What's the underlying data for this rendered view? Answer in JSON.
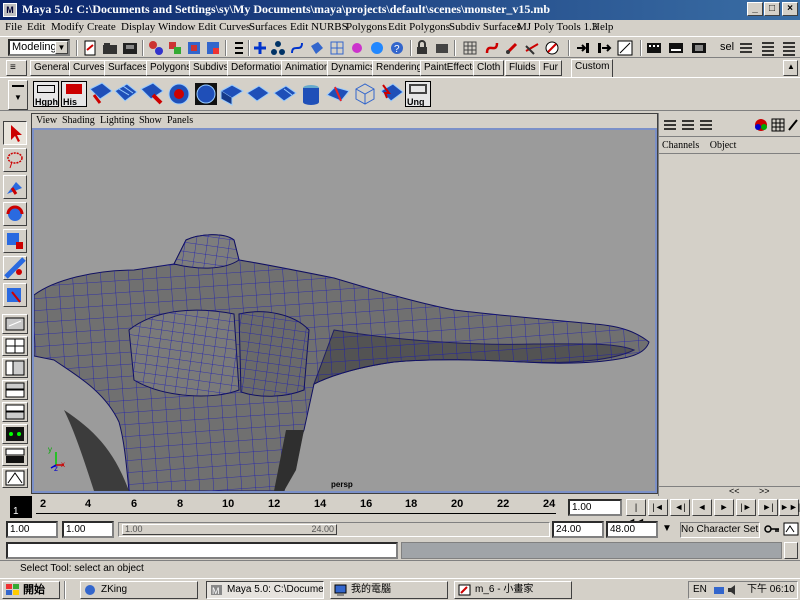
{
  "window": {
    "title": "Maya 5.0: C:\\Documents and Settings\\sy\\My Documents\\maya\\projects\\default\\scenes\\monster_v15.mb",
    "app_icon": "M"
  },
  "menubar": [
    "File",
    "Edit",
    "Modify",
    "Create",
    "Display",
    "Window",
    "Edit Curves",
    "Surfaces",
    "Edit NURBS",
    "Polygons",
    "Edit Polygons",
    "Subdiv Surfaces",
    "MJ Poly Tools 1.3",
    "Help"
  ],
  "status_line": {
    "menu_set": "Modeling",
    "sel_label": "sel"
  },
  "shelf_tabs": [
    "General",
    "Curves",
    "Surfaces",
    "Polygons",
    "Subdivs",
    "Deformation",
    "Animation",
    "Dynamics",
    "Rendering",
    "PaintEffects",
    "Cloth",
    "Fluids",
    "Fur",
    "Custom"
  ],
  "shelf_active": "Custom",
  "shelf_items": [
    {
      "label": "Hgph",
      "icon": "hypergraph-icon"
    },
    {
      "label": "His",
      "icon": "history-icon"
    },
    {
      "label": "",
      "icon": "poly-split-icon"
    },
    {
      "label": "",
      "icon": "poly-extrude-icon"
    },
    {
      "label": "",
      "icon": "poly-append-icon"
    },
    {
      "label": "",
      "icon": "poly-smooth-icon"
    },
    {
      "label": "",
      "icon": "poly-merge-icon"
    },
    {
      "label": "",
      "icon": "poly-cube-icon"
    },
    {
      "label": "",
      "icon": "poly-plane-icon"
    },
    {
      "label": "",
      "icon": "poly-cylinder-icon"
    },
    {
      "label": "",
      "icon": "poly-sphere-icon"
    },
    {
      "label": "",
      "icon": "nurbs-plane-icon"
    },
    {
      "label": "",
      "icon": "poly-wire-icon"
    },
    {
      "label": "",
      "icon": "poly-select-icon"
    },
    {
      "label": "Ung",
      "icon": "ungroup-icon"
    }
  ],
  "viewport": {
    "menu": [
      "View",
      "Shading",
      "Lighting",
      "Show",
      "Panels"
    ],
    "camera": "persp",
    "axis": {
      "y": "y",
      "x": "x",
      "z": "z"
    }
  },
  "channel_box": {
    "menu": [
      "Channels",
      "Object"
    ],
    "scroll_left": "<<",
    "scroll_right": ">>"
  },
  "time_slider": {
    "ticks": [
      "2",
      "4",
      "6",
      "8",
      "10",
      "12",
      "14",
      "16",
      "18",
      "20",
      "22",
      "24"
    ],
    "current_frame": "1",
    "current_time_field": "1.00"
  },
  "range_slider": {
    "start": "1.00",
    "playback_start": "1.00",
    "thumb_start": "1.00",
    "thumb_end": "24.00",
    "playback_end": "24.00",
    "end": "48.00",
    "character_set": "No Character Set"
  },
  "playback": [
    "|◄◄",
    "|◄",
    "◄|",
    "◄",
    "►",
    "|►",
    "►|",
    "►►|"
  ],
  "help_line": "Select Tool: select an object",
  "taskbar": {
    "start": "開始",
    "tasks": [
      {
        "label": "ZKing",
        "pressed": false
      },
      {
        "label": "Maya 5.0: C:\\Docume...",
        "pressed": true
      },
      {
        "label": "我的電腦",
        "pressed": false
      },
      {
        "label": "m_6 - 小畫家",
        "pressed": false
      }
    ],
    "tray_lang": "EN",
    "clock": "下午 06:10"
  },
  "colors": {
    "title_start": "#0a246a",
    "title_end": "#3a6ea5",
    "viewport_bg": "#9b9b9b",
    "wire": "#1b1bb4",
    "mesh": "#6e6e6e"
  }
}
